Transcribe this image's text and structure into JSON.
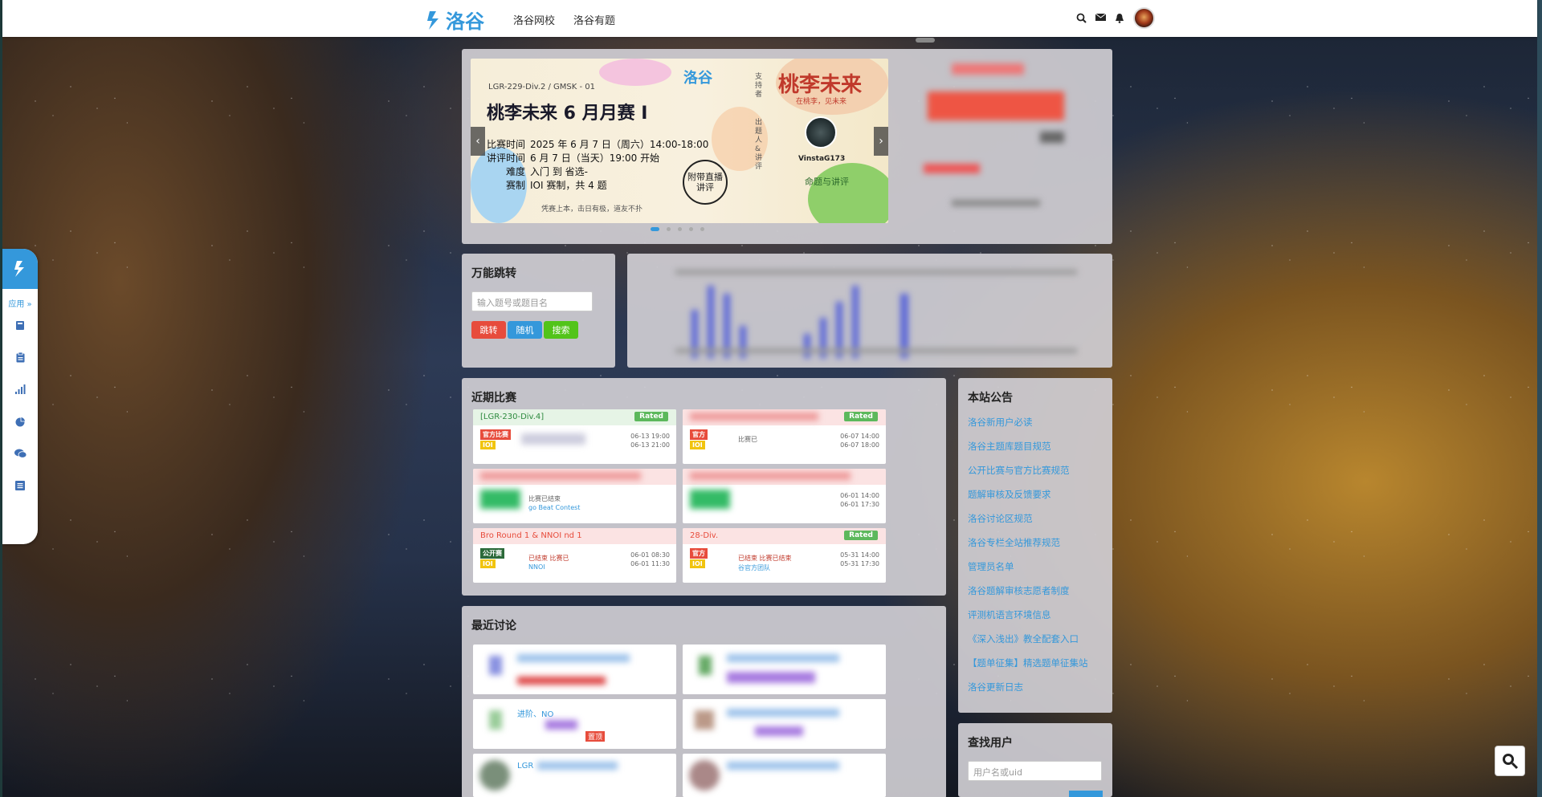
{
  "nav": {
    "logo_text": "洛谷",
    "links": [
      "洛谷网校",
      "洛谷有题"
    ],
    "icons": [
      "search-icon",
      "mail-icon",
      "bell-icon"
    ]
  },
  "dock": {
    "app_label": "应用 »",
    "icons": [
      "book-icon",
      "clipboard-icon",
      "bar-chart-icon",
      "pie-chart-icon",
      "comments-icon",
      "list-icon"
    ]
  },
  "banner": {
    "contest_id": "LGR-229-Div.2 / GMSK - 01",
    "title": "桃李未来 6 月月赛 I",
    "rows": [
      {
        "k": "比赛时间",
        "v": "2025 年 6 月 7 日（周六）14:00-18:00"
      },
      {
        "k": "讲评时间",
        "v": "6 月 7 日（当天）19:00 开始"
      },
      {
        "k": "难度",
        "v": "入门 到 省选-"
      },
      {
        "k": "赛制",
        "v": "IOI 赛制，共 4 题"
      }
    ],
    "footer": "凭赛上本，击日有极，道友不扑",
    "logo": "洛谷",
    "vertical_text": "支持者",
    "vertical_text_2": "出题人&讲评",
    "right_title": "桃李未来",
    "right_subtitle": "在桃李，见未来",
    "author_name": "VinstaG173",
    "author_role": "命题与讲评",
    "stamp": "附带直播讲评"
  },
  "jump": {
    "title": "万能跳转",
    "placeholder": "输入题号或题目名",
    "btn_jump": "跳转",
    "btn_random": "随机",
    "btn_search": "搜索",
    "btn_colors": {
      "jump": "#e74c3c",
      "random": "#3498db",
      "search": "#52c41a"
    }
  },
  "contests": {
    "title": "近期比赛",
    "items": [
      {
        "title": "[LGR-230-Div.4]",
        "rated": "Rated",
        "type": "官方比赛",
        "mode": "IOI",
        "dates": [
          "06-13 19:00",
          "06-13 21:00"
        ],
        "status": "",
        "team": ""
      },
      {
        "title": "",
        "rated": "Rated",
        "type": "官方",
        "mode": "IOI",
        "dates": [
          "06-07 14:00",
          "06-07 18:00"
        ],
        "status": "比赛已",
        "team": ""
      },
      {
        "title": "",
        "rated": "",
        "type": "",
        "mode": "",
        "dates": [
          "",
          ""
        ],
        "status": "比赛已结束",
        "team": "go Beat Contest"
      },
      {
        "title": "",
        "rated": "",
        "type": "",
        "mode": "",
        "dates": [
          "06-01 14:00",
          "06-01 17:30"
        ],
        "status": "",
        "team": ""
      },
      {
        "title": "Bro Round 1 & NNOI nd 1",
        "rated": "",
        "type": "公开赛",
        "mode": "IOI",
        "dates": [
          "06-01 08:30",
          "06-01 11:30"
        ],
        "status": "已结束 比赛已",
        "team": "NNOI"
      },
      {
        "title": "28-Div.",
        "rated": "Rated",
        "type": "官方",
        "mode": "IOI",
        "dates": [
          "05-31 14:00",
          "05-31 17:30"
        ],
        "status": "已结束 比赛已结束",
        "team": "谷官方团队"
      }
    ]
  },
  "notices": {
    "title": "本站公告",
    "items": [
      "洛谷新用户必读",
      "洛谷主题库题目规范",
      "公开比赛与官方比赛规范",
      "题解审核及反馈要求",
      "洛谷讨论区规范",
      "洛谷专栏全站推荐规范",
      "管理员名单",
      "洛谷题解审核志愿者制度",
      "评测机语言环境信息",
      "《深入浅出》教全配套入口",
      "【题单征集】精选题单征集站",
      "洛谷更新日志"
    ]
  },
  "discuss": {
    "title": "最近讨论",
    "snippets": [
      "进阶、NO",
      "置顶",
      "LGR"
    ]
  },
  "finduser": {
    "title": "查找用户",
    "placeholder": "用户名或uid"
  }
}
